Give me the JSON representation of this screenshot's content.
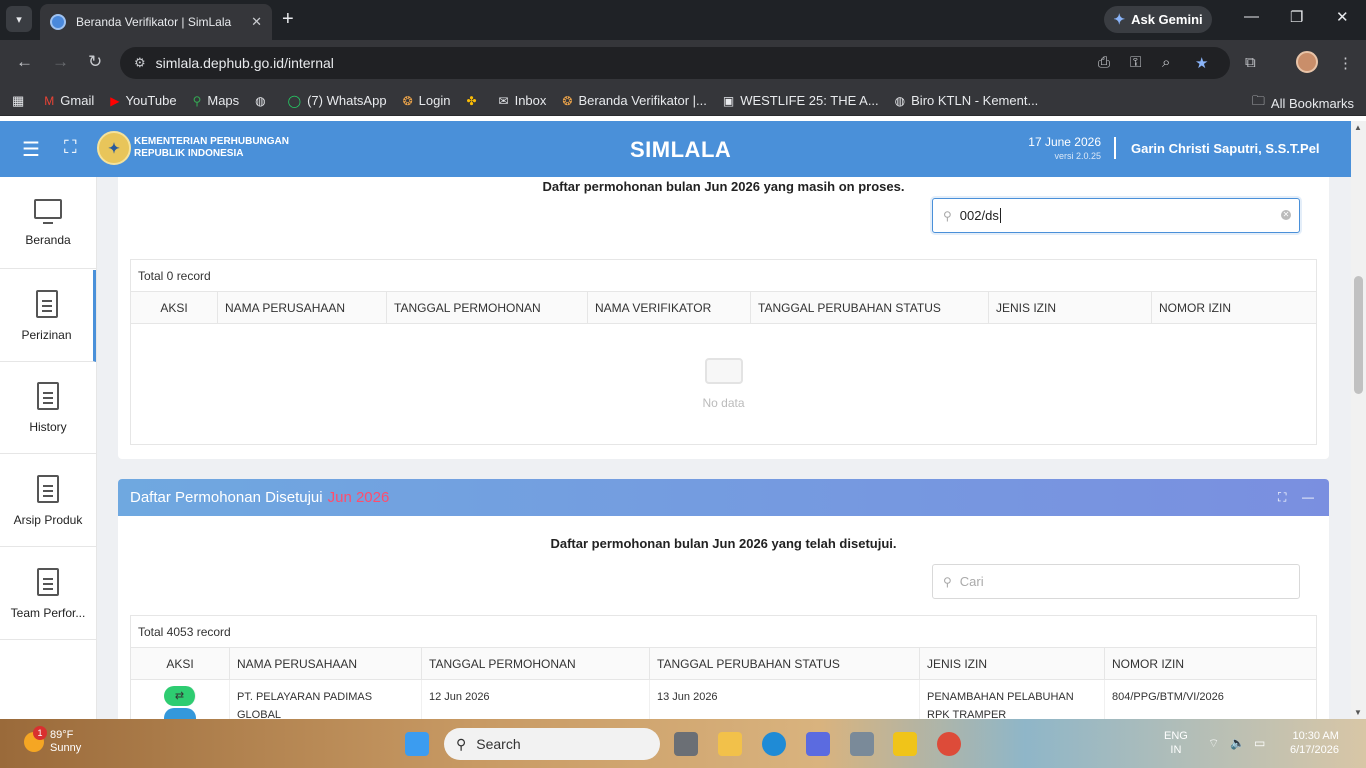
{
  "browser": {
    "tab_title": "Beranda Verifikator | SimLala",
    "url": "simlala.dephub.go.id/internal",
    "gemini_label": "Ask Gemini",
    "bookmarks": [
      {
        "label": "Gmail",
        "icon": "gmail-icon"
      },
      {
        "label": "YouTube",
        "icon": "youtube-icon"
      },
      {
        "label": "Maps",
        "icon": "maps-icon"
      },
      {
        "label": "",
        "icon": "globe-icon"
      },
      {
        "label": "(7) WhatsApp",
        "icon": "whatsapp-icon"
      },
      {
        "label": "Login",
        "icon": "login-icon"
      },
      {
        "label": "",
        "icon": "pinwheel-icon"
      },
      {
        "label": "Inbox",
        "icon": "mail-icon"
      },
      {
        "label": "Beranda Verifikator |...",
        "icon": "simlala-icon"
      },
      {
        "label": "WESTLIFE 25: THE A...",
        "icon": "bookmark-icon"
      },
      {
        "label": "Biro KTLN - Kement...",
        "icon": "globe-icon"
      }
    ],
    "all_bookmarks_label": "All Bookmarks"
  },
  "header": {
    "org_line1": "KEMENTERIAN PERHUBUNGAN",
    "org_line2": "REPUBLIK INDONESIA",
    "app_title": "SIMLALA",
    "date": "17 June 2026",
    "version": "versi 2.0.25",
    "user": "Garin Christi Saputri, S.S.T.Pel"
  },
  "sidebar": {
    "items": [
      {
        "label": "Beranda",
        "icon": "monitor-icon"
      },
      {
        "label": "Perizinan",
        "icon": "document-icon"
      },
      {
        "label": "History",
        "icon": "document-icon"
      },
      {
        "label": "Arsip Produk",
        "icon": "document-icon"
      },
      {
        "label": "Team Perfor...",
        "icon": "document-icon"
      }
    ]
  },
  "onprocess": {
    "subtitle": "Daftar permohonan bulan Jun 2026 yang masih on proses.",
    "search_value": "002/ds",
    "total": "Total 0 record",
    "columns": [
      "AKSI",
      "NAMA PERUSAHAAN",
      "TANGGAL PERMOHONAN",
      "NAMA VERIFIKATOR",
      "TANGGAL PERUBAHAN STATUS",
      "JENIS IZIN",
      "NOMOR IZIN"
    ],
    "empty_text": "No data"
  },
  "approved": {
    "title": "Daftar Permohonan Disetujui",
    "title_accent": "Jun 2026",
    "subtitle": "Daftar permohonan bulan Jun 2026 yang telah disetujui.",
    "search_placeholder": "Cari",
    "total": "Total 4053 record",
    "columns": [
      "AKSI",
      "NAMA PERUSAHAAN",
      "TANGGAL PERMOHONAN",
      "TANGGAL PERUBAHAN STATUS",
      "JENIS IZIN",
      "NOMOR IZIN"
    ],
    "rows": [
      {
        "company": "PT. PELAYARAN PADIMAS GLOBAL",
        "request_date": "12 Jun 2026",
        "status_date": "13 Jun 2026",
        "permit_type": "PENAMBAHAN PELABUHAN RPK TRAMPER",
        "permit_no": "804/PPG/BTM/VI/2026"
      }
    ]
  },
  "taskbar": {
    "temp": "89°F",
    "weather": "Sunny",
    "notif_count": "1",
    "search_label": "Search",
    "lang1": "ENG",
    "lang2": "IN",
    "time": "10:30 AM",
    "date": "6/17/2026"
  },
  "colors": {
    "header_blue": "#4a90d9",
    "accent_red": "#ff4d6d",
    "action_green": "#2ecc71"
  }
}
